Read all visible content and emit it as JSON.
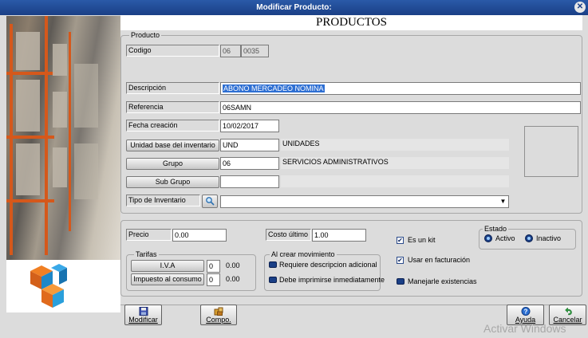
{
  "window": {
    "title": "Modificar Producto:",
    "close_icon": "close-icon"
  },
  "header": {
    "title": "PRODUCTOS"
  },
  "producto": {
    "group_label": "Producto",
    "codigo": {
      "label": "Codigo",
      "prefix": "06",
      "value": "0035"
    },
    "descripcion": {
      "label": "Descripción",
      "value": "ABONO MERCADEO NOMINA"
    },
    "referencia": {
      "label": "Referencia",
      "value": "06SAMN"
    },
    "fecha": {
      "label": "Fecha creación",
      "value": "10/02/2017"
    },
    "unidad": {
      "button": "Unidad base del inventario",
      "value": "UND",
      "desc": "UNIDADES"
    },
    "grupo": {
      "button": "Grupo",
      "value": "06",
      "desc": "SERVICIOS ADMINISTRATIVOS"
    },
    "subgrupo": {
      "button": "Sub Grupo",
      "value": "",
      "desc": ""
    },
    "tipo": {
      "label": "Tipo de Inventario",
      "value": ""
    }
  },
  "precios": {
    "precio": {
      "label": "Precio",
      "value": "0.00"
    },
    "costo": {
      "label": "Costo último",
      "value": "1.00"
    }
  },
  "tarifas": {
    "group_label": "Tarifas",
    "iva": {
      "button": "I.V.A",
      "code": "0",
      "value": "0.00"
    },
    "impuesto": {
      "button": "Impuesto al consumo",
      "code": "0",
      "value": "0.00"
    }
  },
  "movimiento": {
    "group_label": "Al crear movimiento",
    "opt1": "Requiere descripcion adicional",
    "opt2": "Debe imprimirse inmediatamente"
  },
  "checks": {
    "kit": "Es un kit",
    "facturacion": "Usar en facturación",
    "existencias": "Manejarle existencias"
  },
  "estado": {
    "group_label": "Estado",
    "activo": "Activo",
    "inactivo": "Inactivo"
  },
  "toolbar": {
    "modificar": "Modificar",
    "compo": "Compo.",
    "ayuda": "Ayuda",
    "cancelar": "Cancelar"
  },
  "watermark": "Activar Windows",
  "colors": {
    "titlebar": "#1a3f86",
    "selection": "#2e6fd3"
  }
}
